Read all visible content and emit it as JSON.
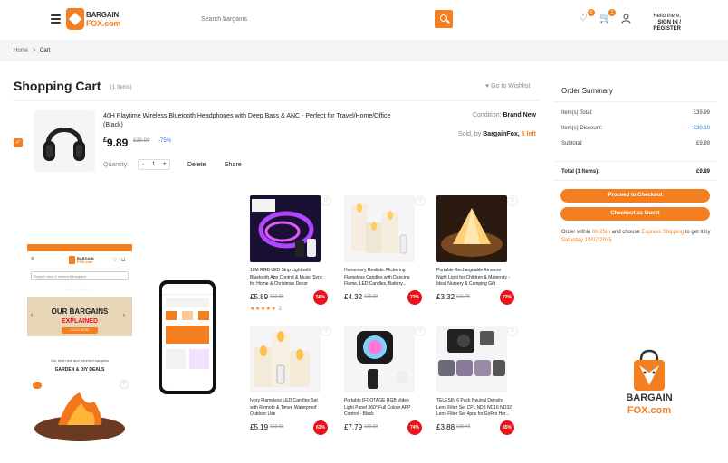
{
  "header": {
    "brand_line1": "BARGAIN",
    "brand_line2": "FOX.com",
    "search_placeholder": "Search bargains",
    "wishlist_count": "0",
    "cart_count": "1",
    "greeting": "Hello there,",
    "signin": "SIGN IN / REGISTER"
  },
  "breadcrumb": {
    "home": "Home",
    "sep": ">",
    "current": "Cart"
  },
  "cart": {
    "title": "Shopping Cart",
    "items_label": "(1 Items)",
    "wishlist_label": "Go to Wishlist",
    "item": {
      "name": "40H Playtime Wireless Bluetooth Headphones with Deep Bass & ANC - Perfect for Travel/Home/Office (Black)",
      "price_symbol": "£",
      "price": "9.89",
      "old_price": "£39.99",
      "discount": "-75%",
      "condition_label": "Condition:",
      "condition_value": "Brand New",
      "sold_label": "Sold, by",
      "seller": "BargainFox,",
      "stock": "6 left",
      "quantity_label": "Quantity:",
      "quantity": "1",
      "minus": "-",
      "plus": "+",
      "delete": "Delete",
      "share": "Share"
    }
  },
  "summary": {
    "title": "Order Summary",
    "total_label": "Item(s) Total:",
    "total_value": "£39.99",
    "discount_label": "Item(s) Discount:",
    "discount_value": "-£30.10",
    "subtotal_label": "Subtotal:",
    "subtotal_value": "£9.89",
    "grand_label": "Total (1 Items):",
    "grand_value": "£9.89",
    "checkout": "Proceed to Checkout",
    "guest": "Checkout as Guest",
    "note_a": "Order within ",
    "note_time": "6h 25m",
    "note_b": " and choose ",
    "note_shipping": "Express Shipping",
    "note_c": " to get it by ",
    "note_date": "Saturday 19/07/2025"
  },
  "products": [
    {
      "title": "10M RGB LED Strip Light with Bluetooth App Control & Music Sync for Home & Christmas Decor",
      "price": "£5.89",
      "old": "£12.99",
      "badge": "56%",
      "stars": "★★★★★",
      "reviews": "2"
    },
    {
      "title": "Homemory Realistic Flickering Flameless Candles with Dancing Flame, LED Candles, Battery...",
      "price": "£4.32",
      "old": "£15.99",
      "badge": "73%"
    },
    {
      "title": "Portable Rechargeable Ammore Night Light for Children & Maternity - Ideal Nursery & Camping Gift",
      "price": "£3.32",
      "old": "£11.75",
      "badge": "72%"
    },
    {
      "title": "Ivory Flameless LED Candles Set with Remote & Timer, Waterproof Outdoor Use",
      "price": "£5.19",
      "old": "£13.99",
      "badge": "63%"
    },
    {
      "title": "Portable IFOOTAGE RGB Video Light Panel 360° Full Colour APP Control - Black",
      "price": "£7.79",
      "old": "£29.99",
      "badge": "74%"
    },
    {
      "title": "TELESIN 6 Pack Neutral Density Lens Filter Set CPL ND8 ND16 ND32 Lens Filter Set 4pcs for GoPro Her...",
      "price": "£3.88",
      "old": "£25.49",
      "badge": "85%"
    }
  ],
  "mockup": {
    "search_placeholder": "Search new & returned bargains",
    "banner_title": "OUR BARGAINS",
    "banner_sub": "EXPLAINED",
    "banner_cta": "CLICK HERE",
    "tagline": "Our best new and returned bargains",
    "section": "GARDEN & DIY DEALS",
    "brand_line1": "BARGAIN",
    "brand_line2": "FOX.com"
  },
  "big_logo": {
    "line1": "BARGAIN",
    "line2": "FOX.com"
  },
  "colors": {
    "accent": "#f47f20",
    "badge": "#e8131b",
    "link": "#2a7bd8"
  }
}
